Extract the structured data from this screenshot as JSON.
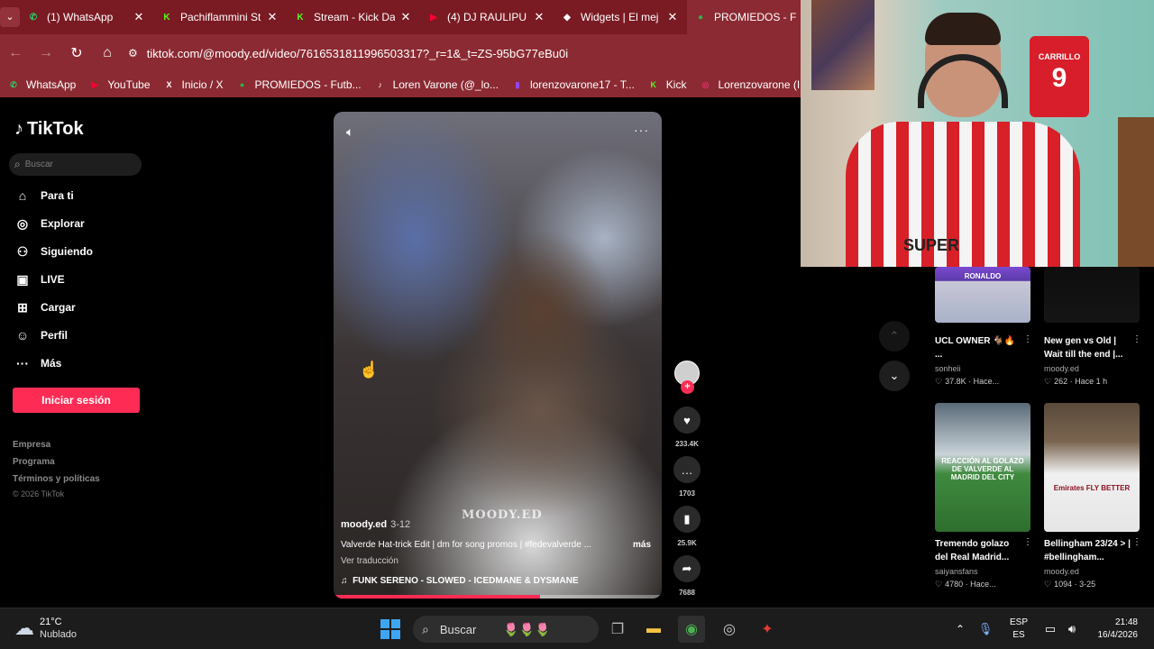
{
  "browser": {
    "tabs": [
      {
        "label": "(1) WhatsApp",
        "icon": "whatsapp-icon",
        "color": "#25d366",
        "glyph": "✆",
        "active": false
      },
      {
        "label": "Pachiflammini St",
        "icon": "kick-icon",
        "color": "#53fc18",
        "glyph": "K",
        "active": false
      },
      {
        "label": "Stream - Kick Da",
        "icon": "kick-icon",
        "color": "#53fc18",
        "glyph": "K",
        "active": false
      },
      {
        "label": "(4) DJ RAULIPU",
        "icon": "youtube-icon",
        "color": "#ff0033",
        "glyph": "▶",
        "active": false
      },
      {
        "label": "Widgets | El mej",
        "icon": "widgets-icon",
        "color": "#ffffff",
        "glyph": "◆",
        "active": false
      },
      {
        "label": "PROMIEDOS - F",
        "icon": "promiedos-icon",
        "color": "#2fb34a",
        "glyph": "●",
        "active": true
      }
    ],
    "url": "tiktok.com/@moody.ed/video/7616531811996503317?_r=1&_t=ZS-95bG77eBu0i",
    "bookmarks": [
      {
        "label": "WhatsApp",
        "icon": "whatsapp-icon",
        "color": "#25d366",
        "glyph": "✆"
      },
      {
        "label": "YouTube",
        "icon": "youtube-icon",
        "color": "#ff0033",
        "glyph": "▶"
      },
      {
        "label": "Inicio / X",
        "icon": "x-icon",
        "color": "#000000",
        "glyph": "X"
      },
      {
        "label": "PROMIEDOS - Futb...",
        "icon": "promiedos-icon",
        "color": "#2fb34a",
        "glyph": "●"
      },
      {
        "label": "Loren Varone (@_lo...",
        "icon": "tiktok-icon",
        "color": "#000000",
        "glyph": "♪"
      },
      {
        "label": "lorenzovarone17 - T...",
        "icon": "twitch-icon",
        "color": "#9146ff",
        "glyph": "▮"
      },
      {
        "label": "Kick",
        "icon": "kick-icon",
        "color": "#53fc18",
        "glyph": "K"
      },
      {
        "label": "Lorenzovarone (Inst...",
        "icon": "instagram-icon",
        "color": "#e1306c",
        "glyph": "◎"
      }
    ]
  },
  "tiktok": {
    "logo": "TikTok",
    "search_placeholder": "Buscar",
    "nav": [
      {
        "label": "Para ti",
        "icon": "home-icon",
        "glyph": "⌂"
      },
      {
        "label": "Explorar",
        "icon": "compass-icon",
        "glyph": "◎"
      },
      {
        "label": "Siguiendo",
        "icon": "following-icon",
        "glyph": "⚇"
      },
      {
        "label": "LIVE",
        "icon": "live-tv-icon",
        "glyph": "▣"
      },
      {
        "label": "Cargar",
        "icon": "upload-icon",
        "glyph": "⊞"
      },
      {
        "label": "Perfil",
        "icon": "profile-icon",
        "glyph": "☺"
      },
      {
        "label": "Más",
        "icon": "more-icon",
        "glyph": "···"
      }
    ],
    "login_label": "Iniciar sesión",
    "footer": [
      "Empresa",
      "Programa",
      "Términos y políticas"
    ],
    "copyright": "© 2026 TikTok"
  },
  "video": {
    "watermark": "MOODY.ED",
    "author": "moody.ed",
    "date": "3-12",
    "caption": "Valverde Hat-trick Edit | dm for song promos | #fedevalverde ...",
    "more": "más",
    "translate": "Ver traducción",
    "music": "FUNK SERENO - SLOWED - ICEDMANE & DYSMANE",
    "progress": 0.63
  },
  "actions": [
    {
      "name": "like",
      "icon": "heart-icon",
      "glyph": "♥",
      "count": "233.4K"
    },
    {
      "name": "comment",
      "icon": "comment-icon",
      "glyph": "…",
      "count": "1703"
    },
    {
      "name": "save",
      "icon": "bookmark-icon",
      "glyph": "▮",
      "count": "25.9K"
    },
    {
      "name": "share",
      "icon": "share-icon",
      "glyph": "➦",
      "count": "7688"
    }
  ],
  "recommendations": [
    {
      "title": "UCL OWNER 🐐🔥 ...",
      "author": "sonheii",
      "stats": "37.8K · Hace...",
      "thumb_text": "RONALDO"
    },
    {
      "title": "New gen vs Old | Wait till the end |...",
      "author": "moody.ed",
      "stats": "262 · Hace 1 h",
      "thumb_text": ""
    },
    {
      "title": "Tremendo golazo del Real Madrid...",
      "author": "saiyansfans",
      "stats": "4780 · Hace...",
      "thumb_text": "REACCIÓN AL GOLAZO DE VALVERDE AL MADRID DEL CITY"
    },
    {
      "title": "Bellingham 23/24 > | #bellingham...",
      "author": "moody.ed",
      "stats": "1094 · 3-25",
      "thumb_text": "Emirates FLY BETTER"
    }
  ],
  "webcam": {
    "shirt_text": "SUPER",
    "hanging_shirt_name": "CARRILLO",
    "hanging_shirt_number": "9"
  },
  "taskbar": {
    "temp": "21°C",
    "weather": "Nublado",
    "search_label": "Buscar",
    "lang_top": "ESP",
    "lang_bottom": "ES",
    "time": "21:48",
    "date": "16/4/2026"
  }
}
